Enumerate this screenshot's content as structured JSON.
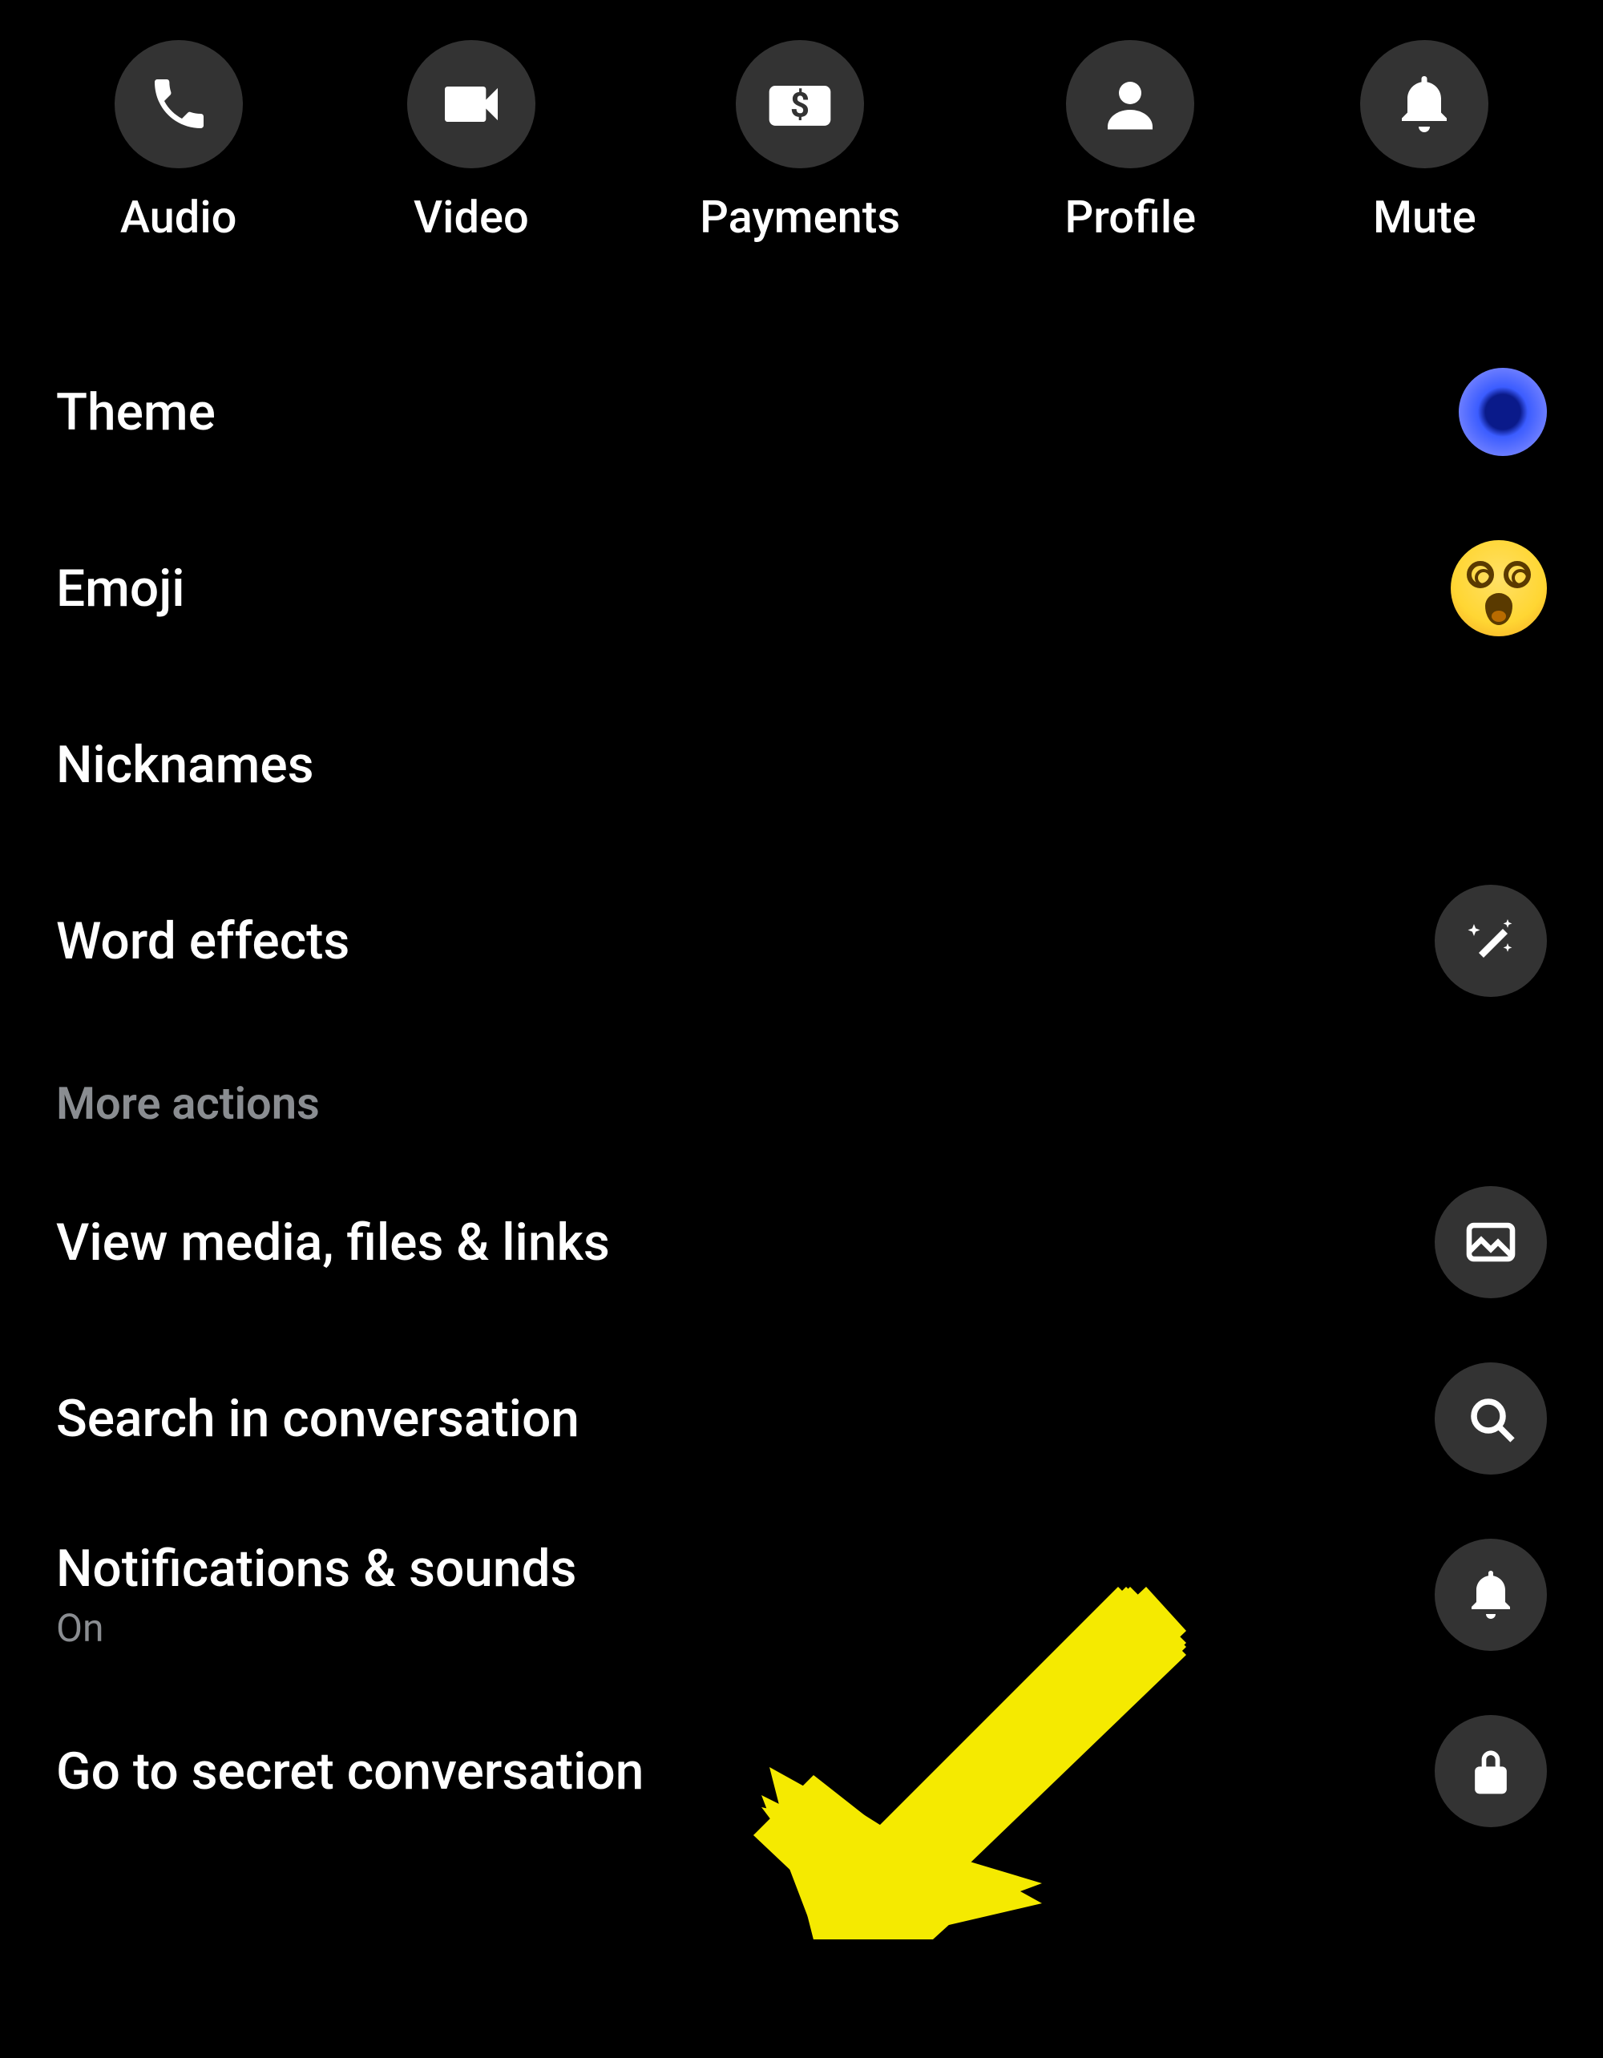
{
  "actions": {
    "audio": {
      "label": "Audio"
    },
    "video": {
      "label": "Video"
    },
    "payments": {
      "label": "Payments"
    },
    "profile": {
      "label": "Profile"
    },
    "mute": {
      "label": "Mute"
    }
  },
  "customization": {
    "theme": {
      "label": "Theme"
    },
    "emoji": {
      "label": "Emoji",
      "emoji_name": "face-with-spiral-eyes"
    },
    "nicknames": {
      "label": "Nicknames"
    },
    "word_effects": {
      "label": "Word effects"
    }
  },
  "more_actions": {
    "header": "More actions",
    "view_media": {
      "label": "View media, files & links"
    },
    "search": {
      "label": "Search in conversation"
    },
    "notifications": {
      "label": "Notifications & sounds",
      "status": "On"
    },
    "secret": {
      "label": "Go to secret conversation"
    }
  },
  "colors": {
    "arrow": "#f5ea00"
  }
}
